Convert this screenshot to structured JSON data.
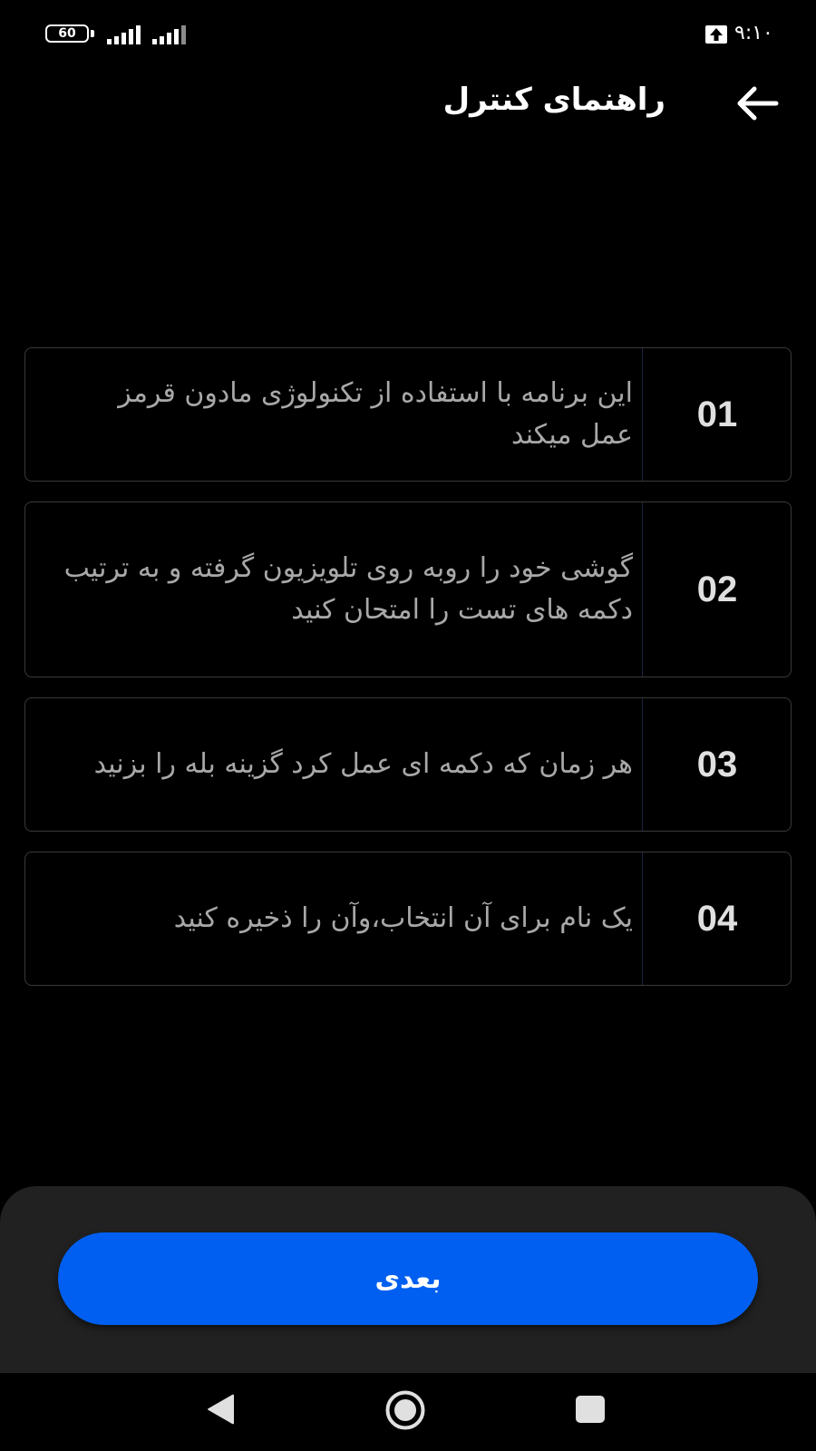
{
  "status_bar": {
    "battery": "60",
    "time": "۹:۱۰",
    "icons": [
      "battery-icon",
      "signal-icon",
      "signal-icon",
      "upload-icon"
    ]
  },
  "header": {
    "title": "راهنمای کنترل",
    "back_icon": "arrow-back-icon"
  },
  "steps": [
    {
      "number": "01",
      "text": "این برنامه با استفاده از تکنولوژی مادون قرمز عمل میکند"
    },
    {
      "number": "02",
      "text": "گوشی خود را روبه روی تلویزیون گرفته و به ترتیب دکمه های تست را امتحان کنید"
    },
    {
      "number": "03",
      "text": "هر زمان که دکمه ای عمل کرد گزینه بله را بزنید"
    },
    {
      "number": "04",
      "text": "یک نام برای آن انتخاب،وآن را ذخیره کنید"
    }
  ],
  "bottom": {
    "next_label": "بعدی"
  },
  "nav_bar": {
    "icons": [
      "nav-back-icon",
      "nav-home-icon",
      "nav-recents-icon"
    ]
  },
  "colors": {
    "background": "#000000",
    "accent": "#005ff0",
    "sheet": "#212121",
    "card_border": "#3a3a3a",
    "step_text": "#a8a8a8"
  }
}
